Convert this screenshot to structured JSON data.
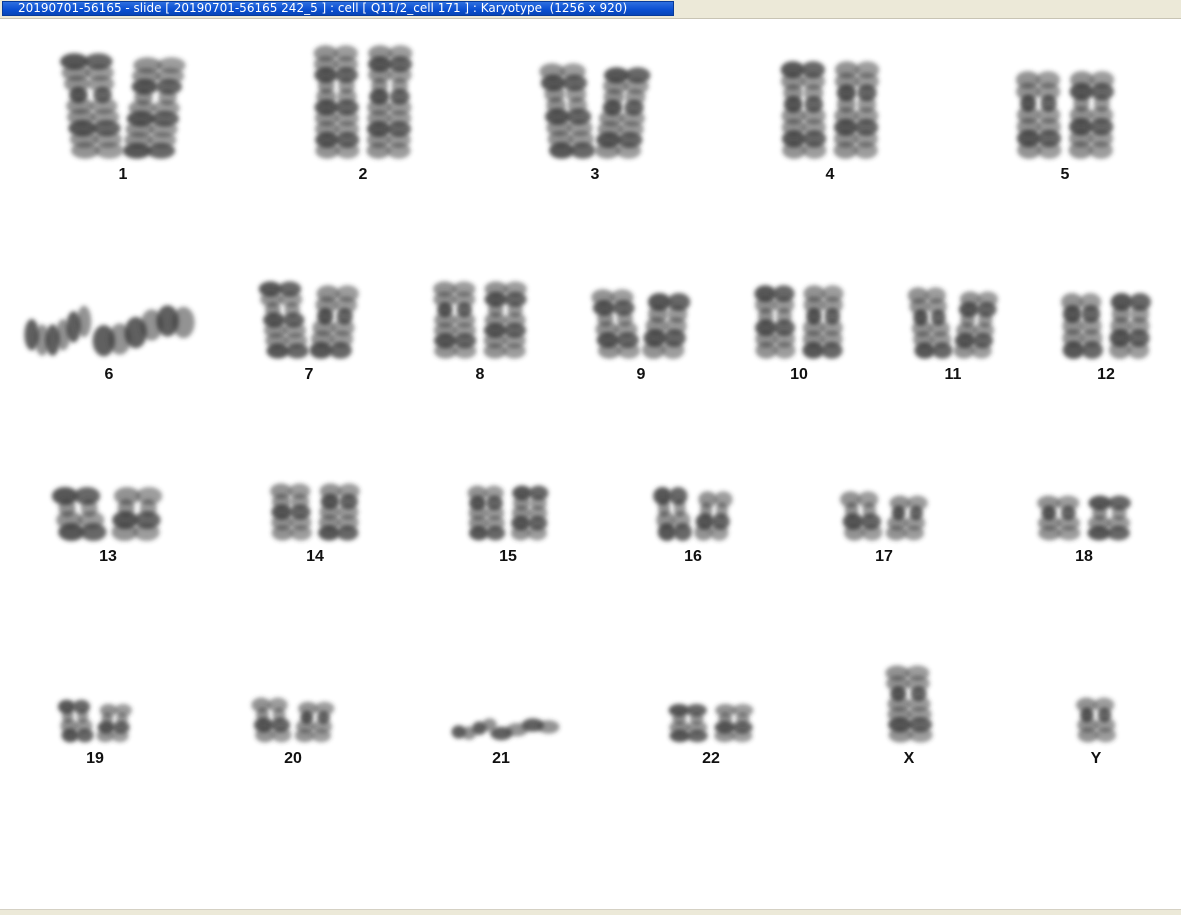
{
  "window": {
    "title": "20190701-56165 - slide [ 20190701-56165 242_5 ] : cell [ Q11/2_cell 171 ] : Karyotype  (1256 x 920)"
  },
  "colors": {
    "title_bar": "#0a4fd1",
    "title_text": "#ffffff",
    "chrome": "#ece9d8",
    "background": "#ffffff",
    "chromatin": "#3a3a3a",
    "label": "#111111"
  },
  "karyotype": {
    "chromosomes": [
      {
        "label": "1"
      },
      {
        "label": "2"
      },
      {
        "label": "3"
      },
      {
        "label": "4"
      },
      {
        "label": "5"
      },
      {
        "label": "6"
      },
      {
        "label": "7"
      },
      {
        "label": "8"
      },
      {
        "label": "9"
      },
      {
        "label": "10"
      },
      {
        "label": "11"
      },
      {
        "label": "12"
      },
      {
        "label": "13"
      },
      {
        "label": "14"
      },
      {
        "label": "15"
      },
      {
        "label": "16"
      },
      {
        "label": "17"
      },
      {
        "label": "18"
      },
      {
        "label": "19"
      },
      {
        "label": "20"
      },
      {
        "label": "21"
      },
      {
        "label": "22"
      },
      {
        "label": "X"
      },
      {
        "label": "Y"
      }
    ]
  }
}
